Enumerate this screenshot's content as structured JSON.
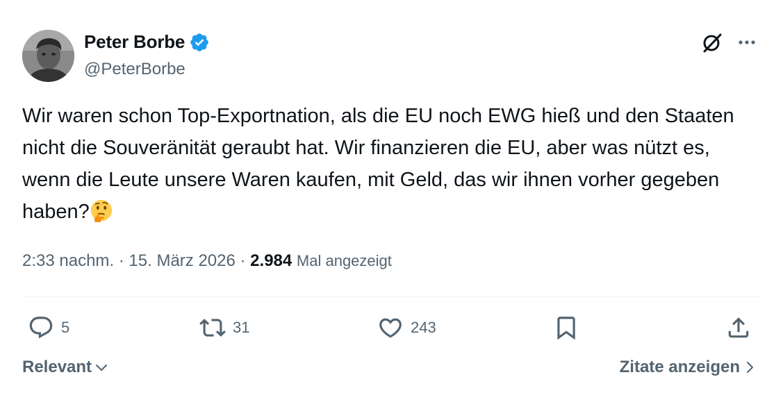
{
  "author": {
    "name": "Peter Borbe",
    "handle": "@PeterBorbe",
    "verified": true
  },
  "tweet": {
    "text": "Wir waren schon Top-Exportnation, als die EU noch EWG hieß und den Staaten nicht die Souveränität geraubt hat. Wir finanzieren die EU, aber was nützt es, wenn die Leute unsere Waren kaufen, mit Geld, das wir ihnen vorher gegeben haben?",
    "emoji": "thinking-face-emoji"
  },
  "meta": {
    "time": "2:33 nachm.",
    "separator": " · ",
    "date": "15. März 2026",
    "views": "2.984",
    "views_label": "Mal angezeigt"
  },
  "actions": {
    "replies": "5",
    "reposts": "31",
    "likes": "243"
  },
  "footer": {
    "sort_label": "Relevant",
    "quotes_label": "Zitate anzeigen"
  },
  "colors": {
    "text": "#0f1419",
    "secondary": "#536471",
    "verified_blue": "#1d9bf0",
    "divider": "#eff3f4"
  }
}
